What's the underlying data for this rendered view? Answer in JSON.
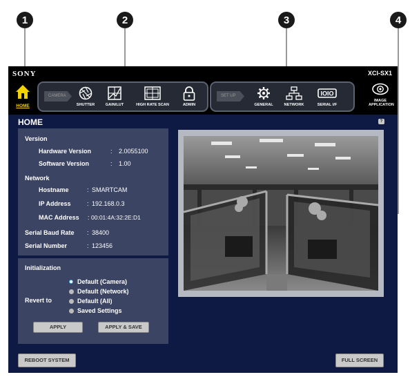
{
  "callouts": {
    "c1": "1",
    "c2": "2",
    "c3": "3",
    "c4": "4"
  },
  "header": {
    "brand": "SONY",
    "model": "XCI-SX1"
  },
  "toolbar": {
    "home": "HOME",
    "camera_group": "CAMERA",
    "shutter": "SHUTTER",
    "gain_lut": "GAIN/LUT",
    "high_rate_scan": "HIGH RATE SCAN",
    "admin": "ADMIN",
    "setup_group": "SET UP",
    "general": "GENERAL",
    "network": "NETWORK",
    "serial": "SERIAL I/F",
    "image_app_1": "IMAGE",
    "image_app_2": "APPLICATION"
  },
  "icons": [
    "home-icon",
    "shutter-icon",
    "gain-lut-icon",
    "high-rate-scan-icon",
    "admin-lock-icon",
    "general-gear-icon",
    "network-icon",
    "serial-interface-icon",
    "image-application-icon",
    "help-icon"
  ],
  "page": {
    "title": "HOME",
    "help": "?"
  },
  "info": {
    "version_heading": "Version",
    "hw_label": "Hardware Version",
    "hw_sep": ":",
    "hw_value": "2.0055100",
    "sw_label": "Software Version",
    "sw_sep": ":",
    "sw_value": "1.00",
    "network_heading": "Network",
    "hostname_label": "Hostname",
    "hostname_sep": ":",
    "hostname_value": "SMARTCAM",
    "ip_label": "IP Address",
    "ip_sep": ":",
    "ip_value": "192.168.0.3",
    "mac_label": "MAC Address",
    "mac_sep": ":",
    "mac_value": "00:01:4A:32:2E:D1",
    "baud_label": "Serial Baud Rate",
    "baud_sep": ":",
    "baud_value": "38400",
    "serial_label": "Serial Number",
    "serial_sep": ":",
    "serial_value": "123456"
  },
  "init": {
    "heading": "Initialization",
    "revert_label": "Revert to",
    "options": [
      "Default (Camera)",
      "Default (Network)",
      "Default (All)",
      "Saved Settings"
    ],
    "selected": "Default (Camera)",
    "apply": "APPLY",
    "apply_save": "APPLY & SAVE"
  },
  "footer": {
    "reboot": "REBOOT SYSTEM",
    "fullscreen": "FULL SCREEN"
  },
  "colors": {
    "frame": "#0f1a44",
    "panel": "#3b4462",
    "topbar": "#000000",
    "home_accent": "#f2d200",
    "radio_selected": "#2d9ee8"
  }
}
